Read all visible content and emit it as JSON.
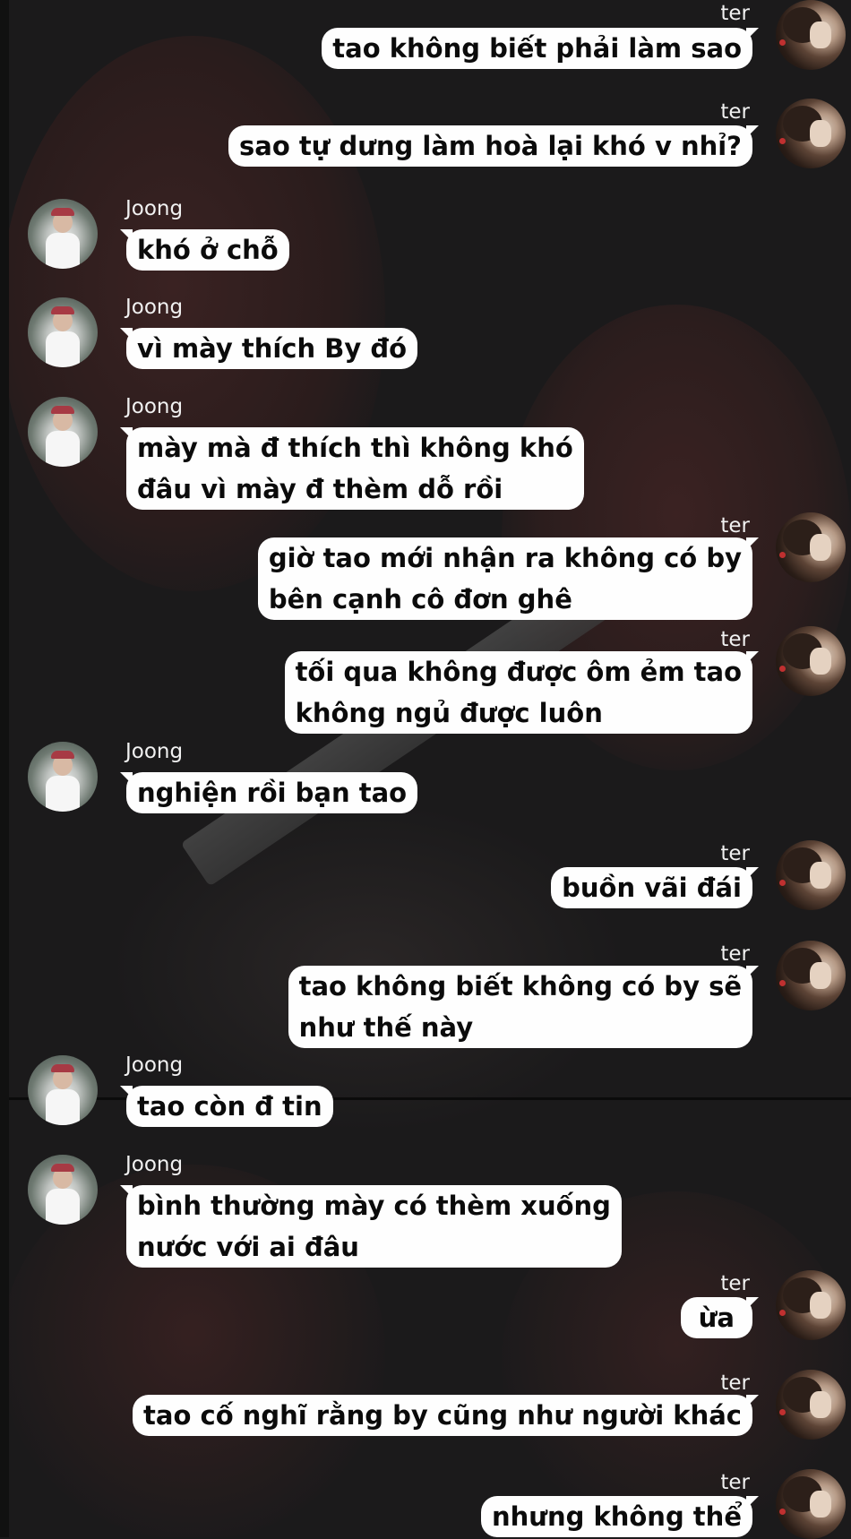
{
  "chat": {
    "messages": [
      {
        "sender": "ter",
        "text": "tao không biết phải làm sao"
      },
      {
        "sender": "ter",
        "text": "sao tự dưng làm hoà lại khó v nhỉ?"
      },
      {
        "sender": "Joong",
        "text": "khó ở chỗ"
      },
      {
        "sender": "Joong",
        "text": "vì mày thích By đó"
      },
      {
        "sender": "Joong",
        "lines": [
          "mày mà đ thích thì không khó",
          "đâu vì mày đ thèm dỗ rồi"
        ]
      },
      {
        "sender": "ter",
        "lines": [
          "giờ tao mới nhận ra không có by",
          "bên cạnh cô đơn ghê"
        ]
      },
      {
        "sender": "ter",
        "lines": [
          "tối qua không được ôm ẻm tao",
          "không ngủ được luôn"
        ]
      },
      {
        "sender": "Joong",
        "text": "nghiện rồi bạn tao"
      },
      {
        "sender": "ter",
        "text": "buồn vãi đái"
      },
      {
        "sender": "ter",
        "lines": [
          "tao không biết không có by sẽ",
          "như thế này"
        ]
      },
      {
        "sender": "Joong",
        "text": "tao còn đ tin"
      },
      {
        "sender": "Joong",
        "lines": [
          "bình thường mày có thèm xuống",
          "nước với ai đâu"
        ]
      },
      {
        "sender": "ter",
        "text": "ừa"
      },
      {
        "sender": "ter",
        "text": "tao cố nghĩ rằng by cũng như người khác"
      },
      {
        "sender": "ter",
        "text": "nhưng không thể"
      }
    ]
  },
  "avatars": {
    "ter": "avatar-ter",
    "Joong": "avatar-joong"
  },
  "colors": {
    "bubble": "#fefefe",
    "text": "#0b0b0b",
    "background": "#1b1a1b"
  }
}
